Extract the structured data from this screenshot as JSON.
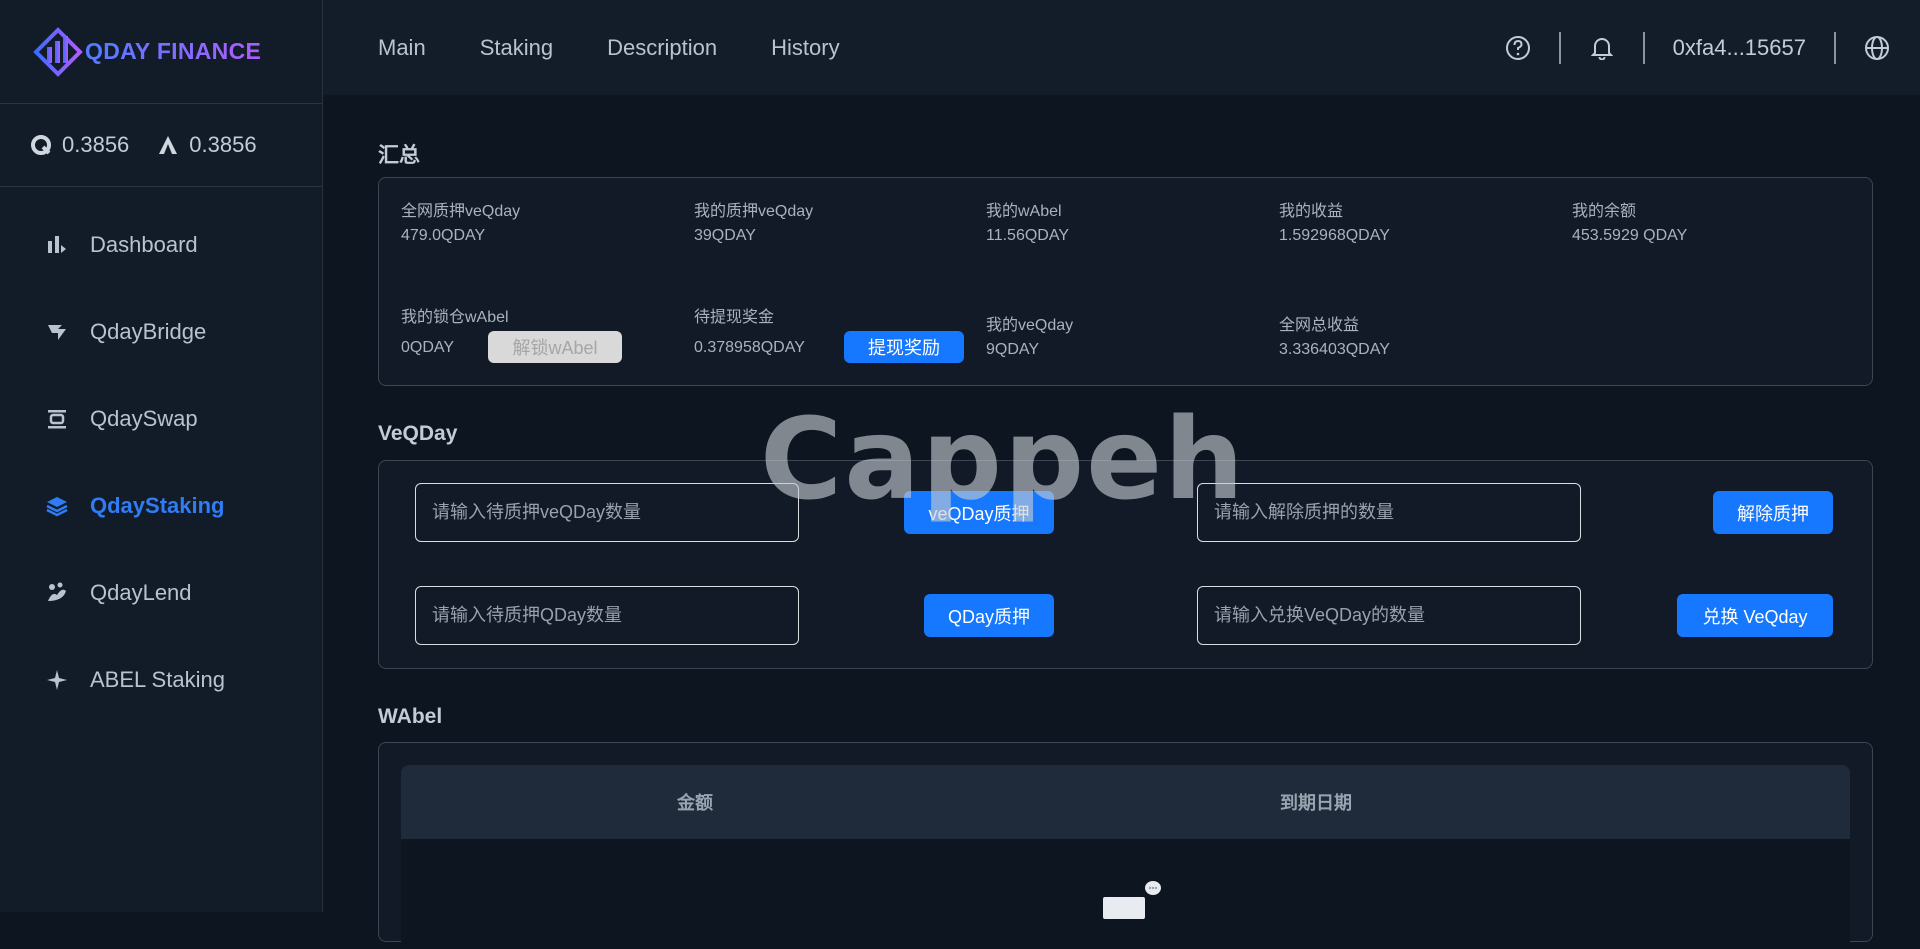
{
  "brand": {
    "name": "QDAY FINANCE"
  },
  "prices": [
    {
      "icon": "qday-token-icon",
      "value": "0.3856"
    },
    {
      "icon": "abel-token-icon",
      "value": "0.3856"
    }
  ],
  "sidebar": {
    "items": [
      {
        "label": "Dashboard",
        "icon": "chart-icon"
      },
      {
        "label": "QdayBridge",
        "icon": "bridge-icon"
      },
      {
        "label": "QdaySwap",
        "icon": "swap-icon"
      },
      {
        "label": "QdayStaking",
        "icon": "layers-icon",
        "active": true
      },
      {
        "label": "QdayLend",
        "icon": "lend-icon"
      },
      {
        "label": "ABEL Staking",
        "icon": "sparkle-icon"
      }
    ]
  },
  "topnav": {
    "items": [
      "Main",
      "Staking",
      "Description",
      "History"
    ]
  },
  "header": {
    "address": "0xfa4...15657"
  },
  "summary": {
    "title": "汇总",
    "stats": [
      {
        "label": "全网质押veQday",
        "value": "479.0QDAY"
      },
      {
        "label": "我的质押veQday",
        "value": "39QDAY"
      },
      {
        "label": "我的wAbel",
        "value": "11.56QDAY"
      },
      {
        "label": "我的收益",
        "value": "1.592968QDAY"
      },
      {
        "label": "我的余额",
        "value": "453.5929 QDAY"
      },
      {
        "label": "我的锁仓wAbel",
        "value": "0QDAY"
      },
      {
        "label": "待提现奖金",
        "value": "0.378958QDAY"
      },
      {
        "label": "我的veQday",
        "value": "9QDAY"
      },
      {
        "label": "全网总收益",
        "value": "3.336403QDAY"
      }
    ],
    "unlock_button": "解锁wAbel",
    "withdraw_button": "提现奖励"
  },
  "veqday": {
    "title": "VeQDay",
    "stake_ve_placeholder": "请输入待质押veQDay数量",
    "stake_ve_button": "veQDay质押",
    "unstake_placeholder": "请输入解除质押的数量",
    "unstake_button": "解除质押",
    "stake_q_placeholder": "请输入待质押QDay数量",
    "stake_q_button": "QDay质押",
    "exchange_placeholder": "请输入兑换VeQDay的数量",
    "exchange_button": "兑换 VeQday"
  },
  "wabel": {
    "title": "WAbel",
    "columns": [
      "金额",
      "到期日期"
    ]
  },
  "watermark": "Cappeh",
  "colors": {
    "accent": "#1677ff",
    "background": "#0d1520",
    "sidebar": "#121c29"
  }
}
